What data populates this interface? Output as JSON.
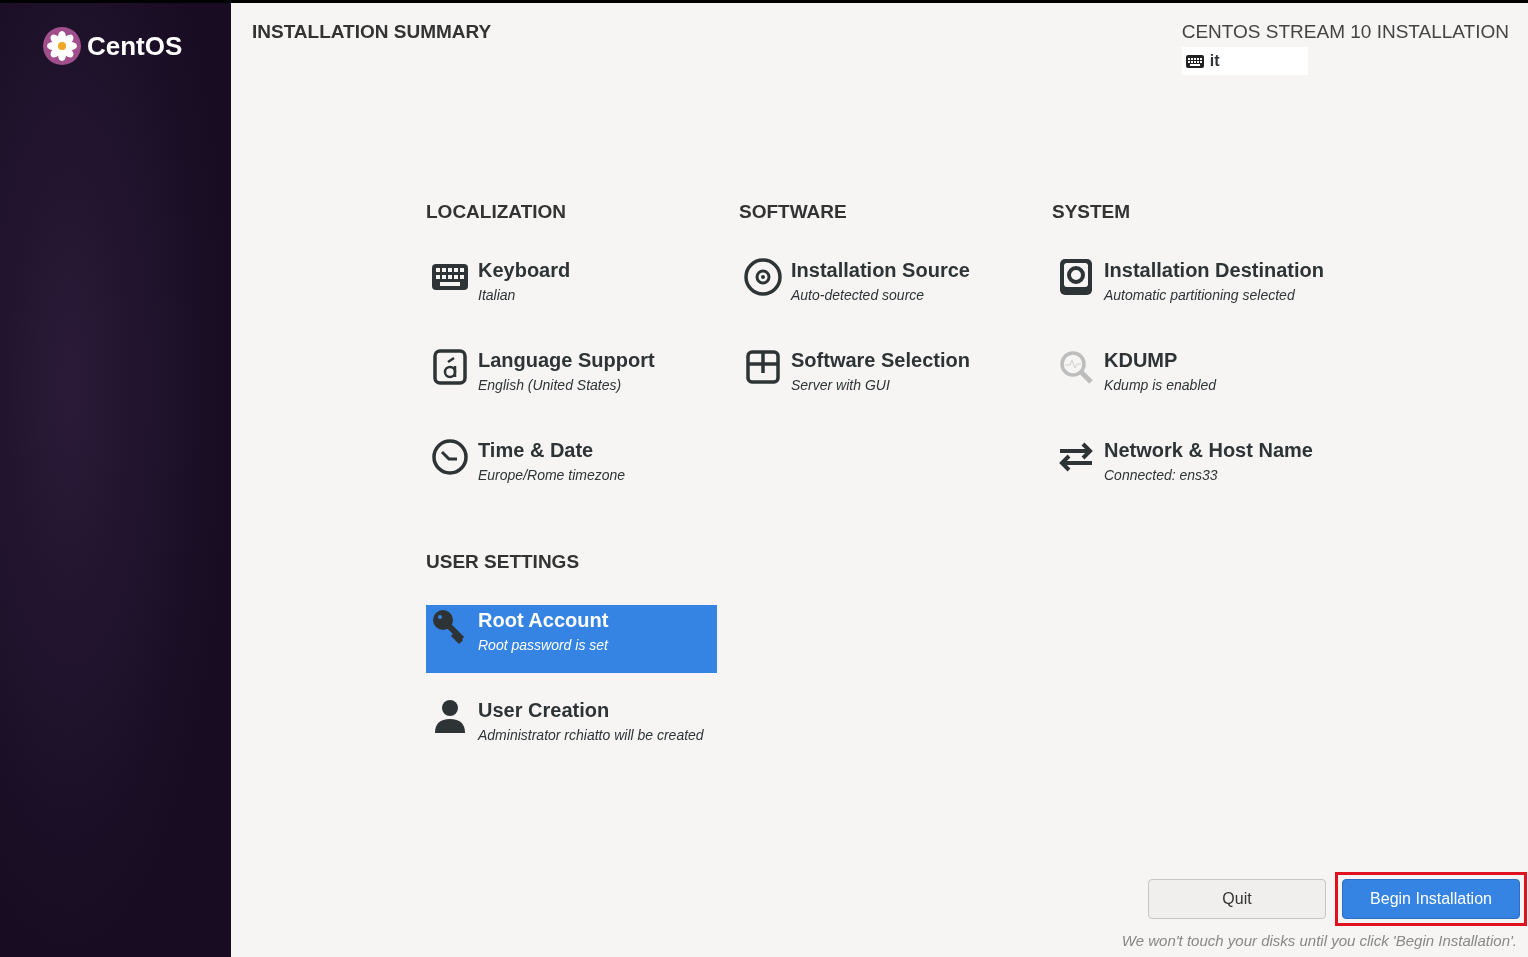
{
  "sidebar": {
    "logo_text": "CentOS"
  },
  "header": {
    "title": "INSTALLATION SUMMARY",
    "product": "CENTOS STREAM 10 INSTALLATION",
    "keyboard_layout": "it"
  },
  "sections": [
    {
      "title": "LOCALIZATION",
      "spokes": [
        {
          "title": "Keyboard",
          "status": "Italian",
          "selected": false
        },
        {
          "title": "Language Support",
          "status": "English (United States)",
          "selected": false
        },
        {
          "title": "Time & Date",
          "status": "Europe/Rome timezone",
          "selected": false
        }
      ]
    },
    {
      "title": "SOFTWARE",
      "spokes": [
        {
          "title": "Installation Source",
          "status": "Auto-detected source",
          "selected": false
        },
        {
          "title": "Software Selection",
          "status": "Server with GUI",
          "selected": false
        }
      ]
    },
    {
      "title": "SYSTEM",
      "spokes": [
        {
          "title": "Installation Destination",
          "status": "Automatic partitioning selected",
          "selected": false
        },
        {
          "title": "KDUMP",
          "status": "Kdump is enabled",
          "selected": false
        },
        {
          "title": "Network & Host Name",
          "status": "Connected: ens33",
          "selected": false
        }
      ]
    },
    {
      "title": "USER SETTINGS",
      "spokes": [
        {
          "title": "Root Account",
          "status": "Root password is set",
          "selected": true
        },
        {
          "title": "User Creation",
          "status": "Administrator rchiatto will be created",
          "selected": false
        }
      ]
    }
  ],
  "footer": {
    "buttons": [
      {
        "label": "Quit",
        "kind": "secondary",
        "highlighted": false
      },
      {
        "label": "Begin Installation",
        "kind": "primary",
        "highlighted": true
      }
    ],
    "note": "We won't touch your disks until you click 'Begin Installation'."
  }
}
